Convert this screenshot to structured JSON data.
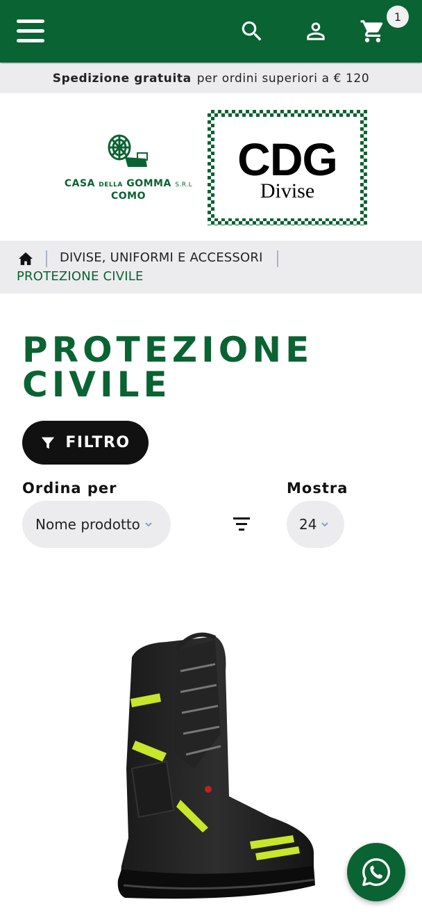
{
  "header": {
    "menu_icon": "hamburger-menu-icon",
    "search_icon": "search-icon",
    "account_icon": "user-account-icon",
    "cart_icon": "shopping-cart-icon",
    "cart_count": "1",
    "brand_color": "#0a6332"
  },
  "shipping_notice": {
    "bold": "Spedizione gratuita",
    "rest": "per ordini superiori a € 120"
  },
  "logos": {
    "left": {
      "line1_a": "CASA",
      "line1_b": "DELLA",
      "line1_c": "GOMMA",
      "line1_suffix": "S.R.L",
      "line2": "COMO"
    },
    "right": {
      "big": "CDG",
      "sub": "Divise"
    }
  },
  "breadcrumb": {
    "home_icon": "home-icon",
    "item1": "DIVISE, UNIFORMI E ACCESSORI",
    "item2": "PROTEZIONE CIVILE"
  },
  "page": {
    "title": "PROTEZIONE CIVILE"
  },
  "filter": {
    "label": "FILTRO",
    "icon": "filter-funnel-icon"
  },
  "sort": {
    "label": "Ordina per",
    "value": "Nome prodotto",
    "direction_icon": "sort-direction-icon"
  },
  "show": {
    "label": "Mostra",
    "value": "24"
  },
  "product": {
    "image": "firefighter-boot-image"
  },
  "whatsapp": {
    "icon": "whatsapp-icon"
  }
}
